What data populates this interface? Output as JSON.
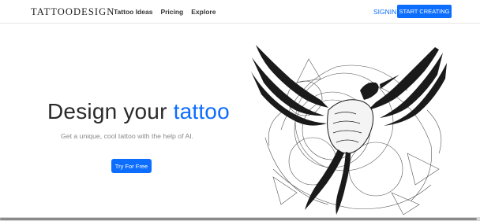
{
  "nav": {
    "brand": "TATTOODESIGN",
    "links": [
      "Tattoo Ideas",
      "Pricing",
      "Explore"
    ],
    "signin": "SIGNIN",
    "cta": "START CREATING"
  },
  "hero": {
    "title_part1": "Design your ",
    "title_accent": "tattoo",
    "subtitle": "Get a unique, cool tattoo with the help of AI.",
    "button": "Try For Free"
  },
  "colors": {
    "accent": "#0d6efd"
  },
  "image": {
    "subject": "sketch-hummingbird-tattoo"
  }
}
